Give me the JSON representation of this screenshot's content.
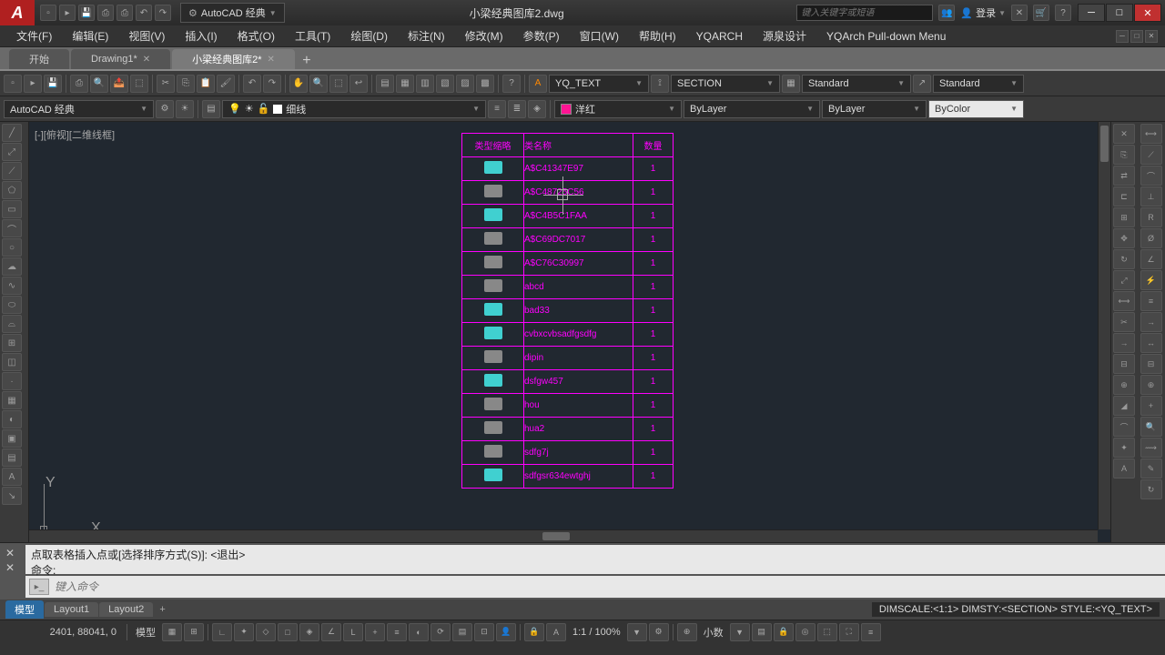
{
  "title": {
    "workspace": "AutoCAD 经典",
    "doc": "小梁经典图库2.dwg",
    "search_placeholder": "键入关键字或短语",
    "login": "登录"
  },
  "menus": [
    "文件(F)",
    "编辑(E)",
    "视图(V)",
    "插入(I)",
    "格式(O)",
    "工具(T)",
    "绘图(D)",
    "标注(N)",
    "修改(M)",
    "参数(P)",
    "窗口(W)",
    "帮助(H)",
    "YQARCH",
    "源泉设计",
    "YQArch Pull-down Menu"
  ],
  "doctabs": {
    "items": [
      {
        "label": "开始",
        "active": false,
        "closeable": false
      },
      {
        "label": "Drawing1*",
        "active": false,
        "closeable": true
      },
      {
        "label": "小梁经典图库2*",
        "active": true,
        "closeable": true
      }
    ]
  },
  "toolbar1": {
    "text_style": "YQ_TEXT",
    "dim_style": "SECTION",
    "table_style": "Standard",
    "mleader_style": "Standard"
  },
  "toolbar2": {
    "workspace": "AutoCAD 经典",
    "layer": "细线",
    "color": "洋红",
    "lineweight": "ByLayer",
    "linetype": "ByLayer",
    "plot": "ByColor"
  },
  "viewport": {
    "label": "[-][俯视][二维线框]",
    "y": "Y",
    "x": "X"
  },
  "table": {
    "headers": [
      "类型缩略",
      "类名称",
      "数量"
    ],
    "rows": [
      {
        "name": "A$C41347E97",
        "count": "1",
        "thumb": "cyan"
      },
      {
        "name": "A$C48725C56",
        "count": "1",
        "thumb": "grey"
      },
      {
        "name": "A$C4B5C1FAA",
        "count": "1",
        "thumb": "cyan"
      },
      {
        "name": "A$C69DC7017",
        "count": "1",
        "thumb": "grey"
      },
      {
        "name": "A$C76C30997",
        "count": "1",
        "thumb": "grey"
      },
      {
        "name": "abcd",
        "count": "1",
        "thumb": "grey"
      },
      {
        "name": "bad33",
        "count": "1",
        "thumb": "cyan"
      },
      {
        "name": "cvbxcvbsadfgsdfg",
        "count": "1",
        "thumb": "cyan"
      },
      {
        "name": "dipin",
        "count": "1",
        "thumb": "grey"
      },
      {
        "name": "dsfgw457",
        "count": "1",
        "thumb": "cyan"
      },
      {
        "name": "hou",
        "count": "1",
        "thumb": "grey"
      },
      {
        "name": "hua2",
        "count": "1",
        "thumb": "grey"
      },
      {
        "name": "sdfg7j",
        "count": "1",
        "thumb": "grey"
      },
      {
        "name": "sdfgsr634ewtghj",
        "count": "1",
        "thumb": "cyan"
      }
    ]
  },
  "command": {
    "hist1": "点取表格插入点或[选择排序方式(S)]: <退出>",
    "hist2": "命令:",
    "placeholder": "键入命令"
  },
  "layouts": {
    "items": [
      "模型",
      "Layout1",
      "Layout2"
    ],
    "active": 0,
    "diminfo": "DIMSCALE:<1:1> DIMSTY:<SECTION> STYLE:<YQ_TEXT>"
  },
  "status": {
    "coords": "2401, 88041, 0",
    "model": "模型",
    "zoom": "1:1 / 100%",
    "annot": "小数"
  }
}
